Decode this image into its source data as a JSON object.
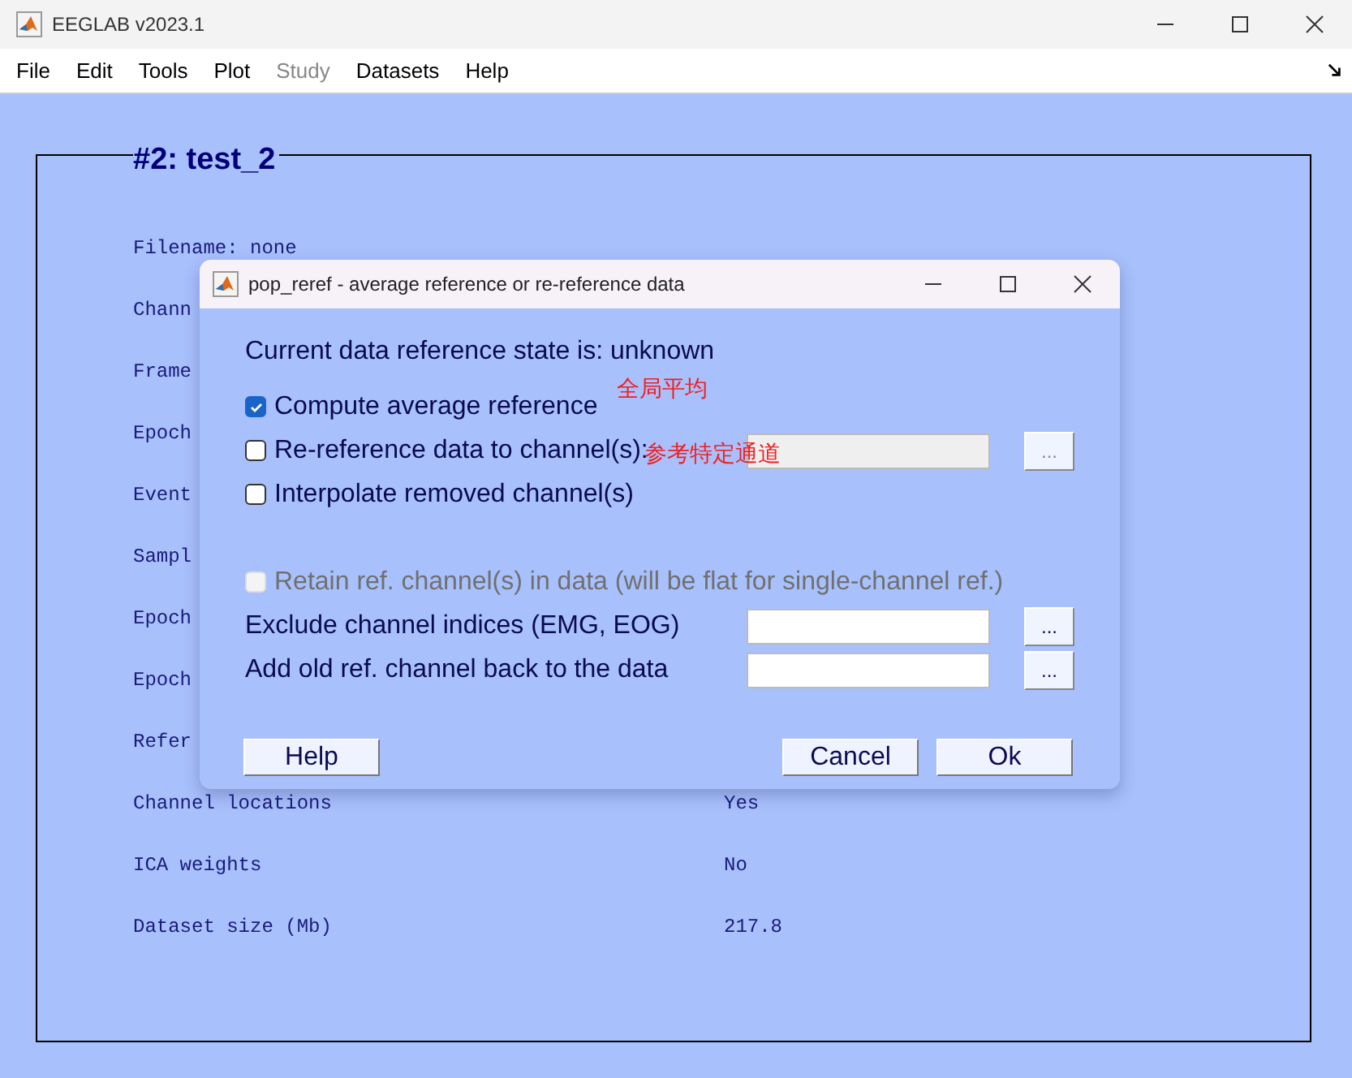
{
  "window": {
    "title": "EEGLAB v2023.1"
  },
  "menu": [
    {
      "label": "File",
      "disabled": false
    },
    {
      "label": "Edit",
      "disabled": false
    },
    {
      "label": "Tools",
      "disabled": false
    },
    {
      "label": "Plot",
      "disabled": false
    },
    {
      "label": "Study",
      "disabled": true
    },
    {
      "label": "Datasets",
      "disabled": false
    },
    {
      "label": "Help",
      "disabled": false
    }
  ],
  "dataset": {
    "title": "#2: test_2",
    "rows": [
      {
        "label": "Filename: none"
      },
      {
        "label": "Chann"
      },
      {
        "label": "Frame"
      },
      {
        "label": "Epoch"
      },
      {
        "label": "Event"
      },
      {
        "label": "Sampl"
      },
      {
        "label": "Epoch"
      },
      {
        "label": "Epoch"
      },
      {
        "label": "Refer"
      },
      {
        "label": "Channel locations",
        "value": "Yes"
      },
      {
        "label": "ICA weights",
        "value": "No"
      },
      {
        "label": "Dataset size (Mb)",
        "value": "217.8"
      }
    ]
  },
  "dialog": {
    "title": "pop_reref - average reference or re-reference data",
    "rows": [
      {
        "kind": "text",
        "label": "Current data reference state is: unknown"
      },
      {
        "kind": "checkbox",
        "label": "Compute average reference",
        "checked": true,
        "disabled": false,
        "note": "全局平均"
      },
      {
        "kind": "checkbox_field",
        "label": "Re-reference data to channel(s):",
        "checked": false,
        "disabled": false,
        "note": "参考特定通道",
        "field_disabled": true,
        "button": "...",
        "button_disabled": true
      },
      {
        "kind": "checkbox",
        "label": "Interpolate removed channel(s)",
        "checked": false,
        "disabled": false
      },
      {
        "kind": "blank"
      },
      {
        "kind": "checkbox",
        "label": "Retain ref. channel(s) in data (will be flat for single-channel ref.)",
        "checked": false,
        "disabled": true
      },
      {
        "kind": "field",
        "label": "Exclude channel indices (EMG, EOG)",
        "field_disabled": false,
        "button": "...",
        "button_disabled": false
      },
      {
        "kind": "field",
        "label": "Add old ref. channel back to the data",
        "field_disabled": false,
        "button": "...",
        "button_disabled": false
      }
    ],
    "buttons": [
      {
        "label": "Help",
        "kind": "left"
      },
      {
        "label": "Cancel",
        "kind": "right"
      },
      {
        "label": "Ok",
        "kind": "right"
      }
    ]
  }
}
